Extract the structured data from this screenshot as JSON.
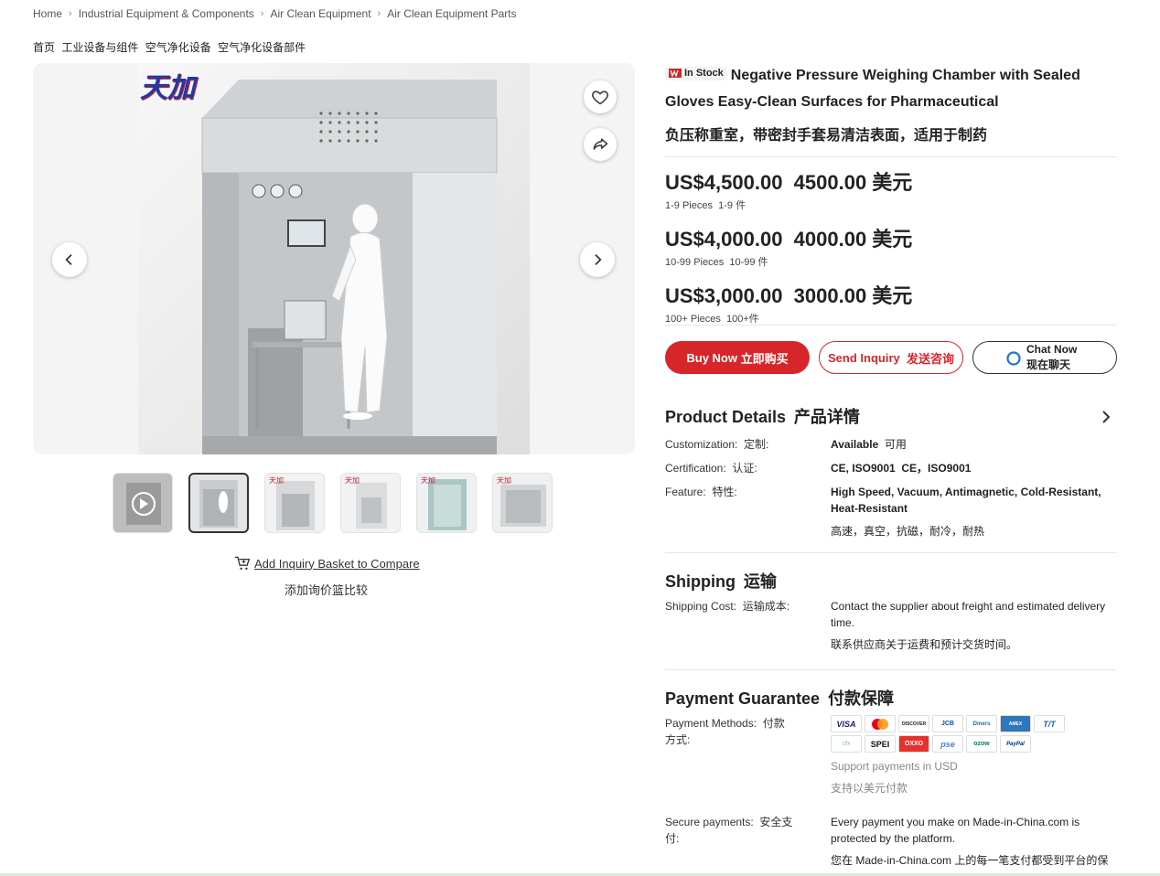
{
  "breadcrumb": {
    "items": [
      "Home",
      "Industrial Equipment & Components",
      "Air Clean Equipment",
      "Air Clean Equipment Parts"
    ],
    "cn": [
      "首页",
      "工业设备与组件",
      "空气净化设备",
      "空气净化设备部件"
    ]
  },
  "gallery": {
    "logo_text": "天加",
    "thumbnail_count": 6
  },
  "compare": {
    "label": "Add Inquiry Basket to Compare",
    "label_cn": "添加询价篮比较"
  },
  "product": {
    "stock_badge": "In Stock",
    "title": "Negative Pressure Weighing Chamber with Sealed Gloves Easy-Clean Surfaces for Pharmaceutical",
    "title_cn": "负压称重室，带密封手套易清洁表面，适用于制药"
  },
  "prices": [
    {
      "price": "US$4,500.00",
      "price_cn": "4500.00 美元",
      "qty": "1-9 Pieces",
      "qty_cn": "1-9 件"
    },
    {
      "price": "US$4,000.00",
      "price_cn": "4000.00 美元",
      "qty": "10-99 Pieces",
      "qty_cn": "10-99 件"
    },
    {
      "price": "US$3,000.00",
      "price_cn": "3000.00 美元",
      "qty": "100+ Pieces",
      "qty_cn": "100+件"
    }
  ],
  "actions": {
    "buy": "Buy Now",
    "buy_cn": "立即购买",
    "inquiry": "Send Inquiry",
    "inquiry_cn": "发送咨询",
    "chat": "Chat Now",
    "chat_cn": "现在聊天"
  },
  "details": {
    "title": "Product Details",
    "title_cn": "产品详情",
    "rows": [
      {
        "label": "Customization:",
        "label_cn": "定制:",
        "value": "Available",
        "value_cn": "可用"
      },
      {
        "label": "Certification:",
        "label_cn": "认证:",
        "value": "CE, ISO9001",
        "value_cn": "CE，ISO9001"
      },
      {
        "label": "Feature:",
        "label_cn": "特性:",
        "value": "High Speed, Vacuum, Antimagnetic, Cold-Resistant, Heat-Resistant",
        "value_cn": "高速，真空，抗磁，耐冷，耐热"
      }
    ]
  },
  "shipping": {
    "title": "Shipping",
    "title_cn": "运输",
    "label": "Shipping Cost:",
    "label_cn": "运输成本:",
    "value": "Contact the supplier about freight and estimated delivery time.",
    "value_cn": "联系供应商关于运费和预计交货时间。"
  },
  "payment": {
    "title": "Payment Guarantee",
    "title_cn": "付款保障",
    "methods_label": "Payment Methods:",
    "methods_label_cn": "付款方式:",
    "methods_row1": [
      "VISA",
      "MC",
      "DISCOVER",
      "JCB",
      "Diners",
      "AMEX",
      "T/T"
    ],
    "methods_row2": [
      "cfx",
      "SPEI",
      "OXXO",
      "pse",
      "ozow",
      "PayPal"
    ],
    "support": "Support payments in USD",
    "support_cn": "支持以美元付款",
    "secure_label": "Secure payments:",
    "secure_label_cn": "安全支付:",
    "secure_value": "Every payment you make on Made-in-China.com is protected by the platform.",
    "secure_value_cn": "您在 Made-in-China.com 上的每一笔支付都受到平台的保"
  }
}
